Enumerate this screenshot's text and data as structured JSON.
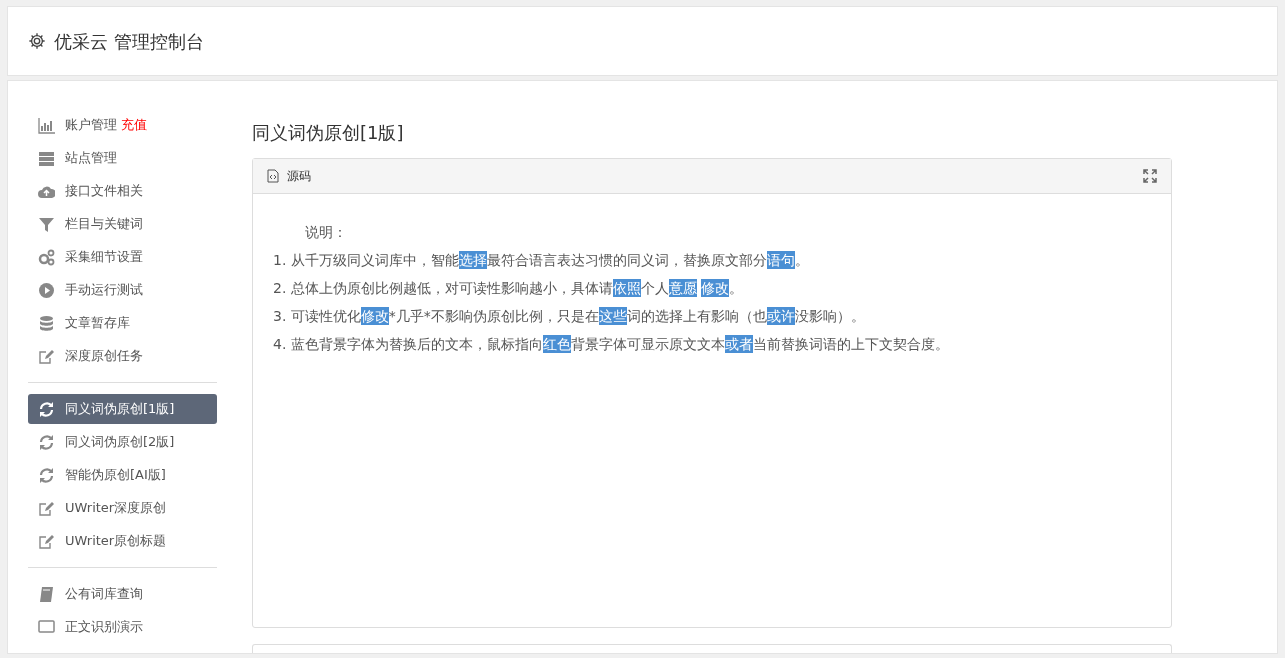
{
  "header": {
    "title": "优采云 管理控制台"
  },
  "sidebar": {
    "groups": [
      {
        "items": [
          {
            "kind": "chart",
            "label": "账户管理",
            "extra": "充值",
            "selected": false
          },
          {
            "kind": "server",
            "label": "站点管理",
            "selected": false
          },
          {
            "kind": "cloud",
            "label": "接口文件相关",
            "selected": false
          },
          {
            "kind": "filter",
            "label": "栏目与关键词",
            "selected": false
          },
          {
            "kind": "gears",
            "label": "采集细节设置",
            "selected": false
          },
          {
            "kind": "play",
            "label": "手动运行测试",
            "selected": false
          },
          {
            "kind": "database",
            "label": "文章暂存库",
            "selected": false
          },
          {
            "kind": "edit",
            "label": "深度原创任务",
            "selected": false
          }
        ]
      },
      {
        "items": [
          {
            "kind": "refresh",
            "label": "同义词伪原创[1版]",
            "selected": true
          },
          {
            "kind": "refresh",
            "label": "同义词伪原创[2版]",
            "selected": false
          },
          {
            "kind": "refresh",
            "label": "智能伪原创[AI版]",
            "selected": false
          },
          {
            "kind": "edit",
            "label": "UWriter深度原创",
            "selected": false
          },
          {
            "kind": "edit",
            "label": "UWriter原创标题",
            "selected": false
          }
        ]
      },
      {
        "items": [
          {
            "kind": "book",
            "label": "公有词库查询",
            "selected": false
          },
          {
            "kind": "monitor",
            "label": "正文识别演示",
            "selected": false
          }
        ]
      }
    ]
  },
  "page": {
    "title": "同义词伪原创[1版]",
    "editor": {
      "toolbar_label": "源码",
      "heading": "说明：",
      "lines": [
        [
          {
            "text": "1. 从千万级同义词库中，智能",
            "highlighted": false
          },
          {
            "text": "选择",
            "highlighted": true
          },
          {
            "text": "最符合语言表达习惯的同义词，替换原文部分",
            "highlighted": false
          },
          {
            "text": "语句",
            "highlighted": true
          },
          {
            "text": "。",
            "highlighted": false
          }
        ],
        [
          {
            "text": "2. 总体上伪原创比例越低，对可读性影响越小，具体请",
            "highlighted": false
          },
          {
            "text": "依照",
            "highlighted": true
          },
          {
            "text": "个人",
            "highlighted": false
          },
          {
            "text": "意愿",
            "highlighted": true
          },
          {
            "text": "修改",
            "highlighted": true
          },
          {
            "text": "。",
            "highlighted": false
          }
        ],
        [
          {
            "text": "3. 可读性优化",
            "highlighted": false
          },
          {
            "text": "修改",
            "highlighted": true
          },
          {
            "text": "*几乎*不影响伪原创比例，只是在",
            "highlighted": false
          },
          {
            "text": "这些",
            "highlighted": true
          },
          {
            "text": "词的选择上有影响（也",
            "highlighted": false
          },
          {
            "text": "或许",
            "highlighted": true
          },
          {
            "text": "没影响）。",
            "highlighted": false
          }
        ],
        [
          {
            "text": "4. 蓝色背景字体为替换后的文本，鼠标指向",
            "highlighted": false
          },
          {
            "text": "红色",
            "highlighted": true
          },
          {
            "text": "背景字体可显示原文文本",
            "highlighted": false
          },
          {
            "text": "或者",
            "highlighted": true
          },
          {
            "text": "当前替换词语的上下文契合度。",
            "highlighted": false
          }
        ]
      ]
    }
  }
}
